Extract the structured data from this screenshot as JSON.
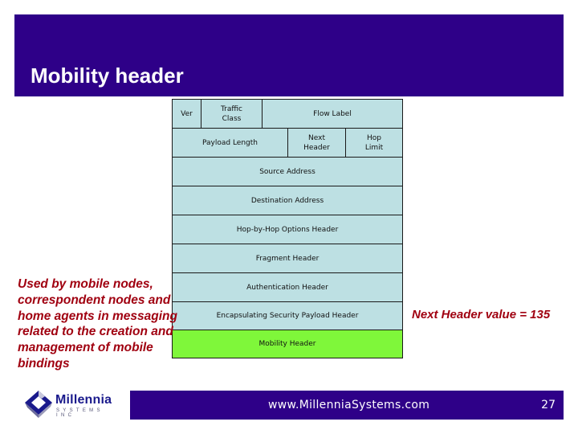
{
  "slide": {
    "title": "Mobility header",
    "page_number": "27"
  },
  "colors": {
    "brand_bar": "#2e0088",
    "cell_fill": "#bde0e3",
    "highlight_fill": "#7ff73a",
    "note_text": "#a00010"
  },
  "diagram": {
    "row1": {
      "ver": "Ver",
      "traffic_class": "Traffic\nClass",
      "flow_label": "Flow Label"
    },
    "row2": {
      "payload_length": "Payload Length",
      "next_header": "Next\nHeader",
      "hop_limit": "Hop\nLimit"
    },
    "rows": [
      "Source Address",
      "Destination Address",
      "Hop-by-Hop Options Header",
      "Fragment Header",
      "Authentication Header",
      "Encapsulating Security Payload Header",
      "Mobility Header"
    ],
    "highlighted_row": "Mobility Header"
  },
  "notes": {
    "left": "Used by mobile nodes, correspondent nodes and home agents in messaging related to the creation and management of mobile bindings",
    "right": "Next Header value = 135"
  },
  "footer": {
    "logo_name": "Millennia",
    "logo_subtitle": "SYSTEMS INC",
    "logo_icon": "diamond-cube-icon",
    "url": "www.MillenniaSystems.com"
  }
}
